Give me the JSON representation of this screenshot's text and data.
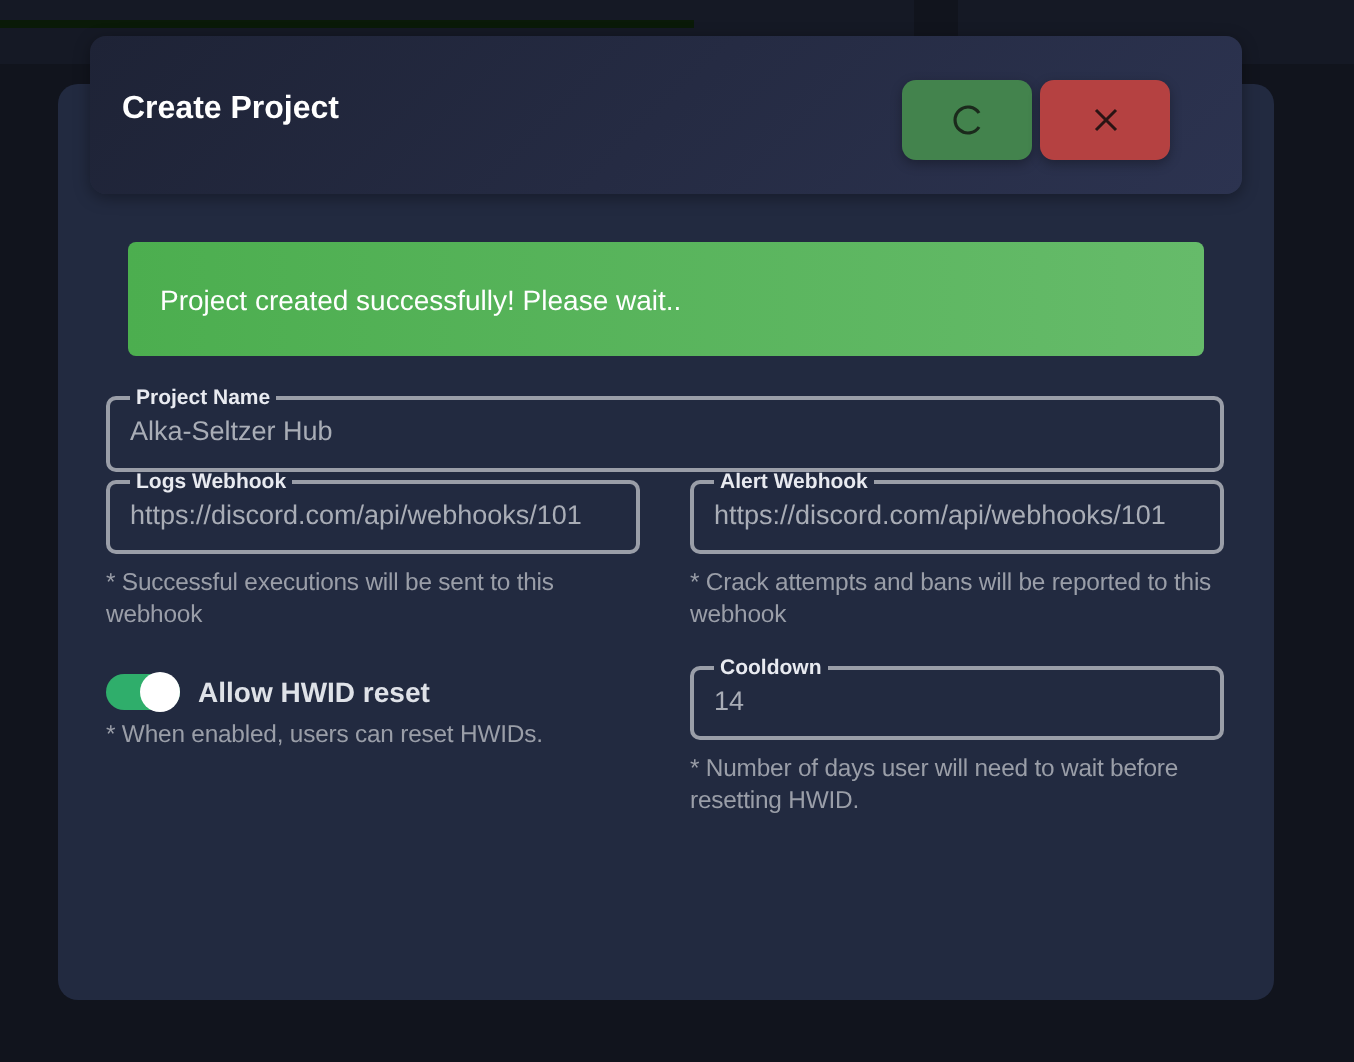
{
  "background_progress": {
    "level": 0.76
  },
  "dialog": {
    "title": "Create Project",
    "buttons": [
      {
        "kind": "loading"
      },
      {
        "kind": "close"
      }
    ]
  },
  "alert": {
    "text": "Project created successfully! Please wait.."
  },
  "fields": [
    {
      "label": "Project Name",
      "value": "Alka-Seltzer Hub"
    },
    {
      "label": "Logs Webhook",
      "value": "https://discord.com/api/webhooks/101",
      "hint": "* Successful executions will be sent to this webhook"
    },
    {
      "label": "Alert Webhook",
      "value": "https://discord.com/api/webhooks/101",
      "hint": "* Crack attempts and bans will be reported to this webhook"
    }
  ],
  "toggle": {
    "label": "Allow HWID reset",
    "on": true,
    "hint": "* When enabled, users can reset HWIDs."
  },
  "cooldown": {
    "label": "Cooldown",
    "value": "14",
    "hint": "* Number of days user will need to wait before resetting HWID."
  }
}
